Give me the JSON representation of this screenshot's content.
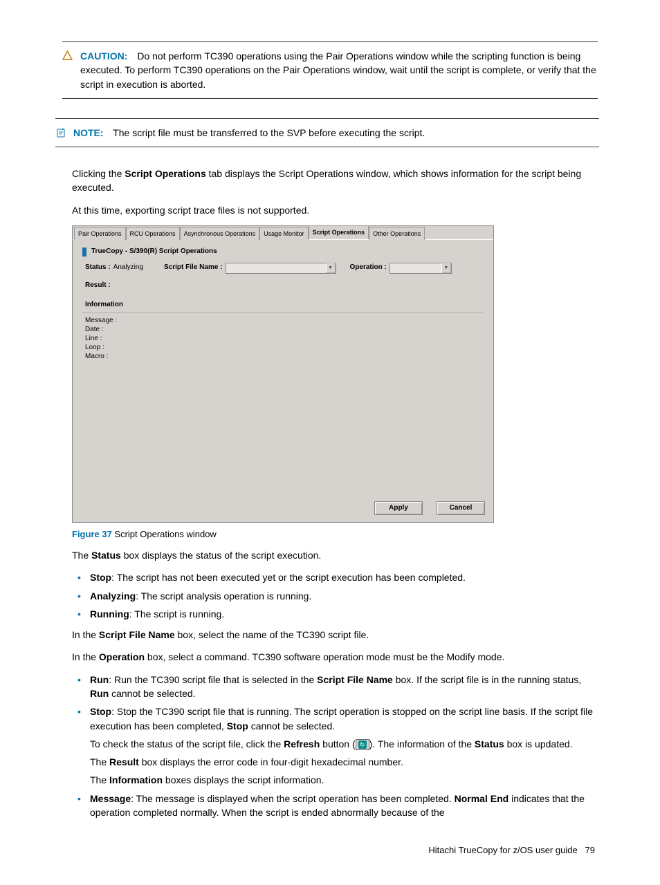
{
  "callouts": {
    "caution": {
      "label": "CAUTION:",
      "text": "Do not perform TC390 operations using the Pair Operations window while the scripting function is being executed. To perform TC390 operations on the Pair Operations window, wait until the script is complete, or verify that the script in execution is aborted."
    },
    "note": {
      "label": "NOTE:",
      "text": "The script file must be transferred to the SVP before executing the script."
    }
  },
  "intro": {
    "p1a": "Clicking the ",
    "p1b": "Script Operations",
    "p1c": " tab displays the Script Operations window, which shows information for the script being executed.",
    "p2": "At this time, exporting script trace files is not supported."
  },
  "app": {
    "tabs": [
      "Pair Operations",
      "RCU Operations",
      "Asynchronous Operations",
      "Usage Monitor",
      "Script Operations",
      "Other Operations"
    ],
    "panel_title": "TrueCopy - S/390(R) Script Operations",
    "labels": {
      "status": "Status :",
      "status_val": "Analyzing",
      "script_file": "Script File Name :",
      "operation": "Operation :",
      "result": "Result :",
      "information": "Information",
      "message": "Message :",
      "date": "Date :",
      "line": "Line :",
      "loop": "Loop :",
      "macro": "Macro :"
    },
    "buttons": {
      "apply": "Apply",
      "cancel": "Cancel"
    }
  },
  "figure": {
    "num": "Figure 37",
    "caption": " Script Operations window"
  },
  "body": {
    "status_line_a": "The ",
    "status_line_b": "Status",
    "status_line_c": " box displays the status of the script execution.",
    "status_items": {
      "stop_b": "Stop",
      "stop_t": ": The script has not been executed yet or the script execution has been completed.",
      "analyzing_b": "Analyzing",
      "analyzing_t": ": The script analysis operation is running.",
      "running_b": "Running",
      "running_t": ": The script is running."
    },
    "sfn_a": "In the ",
    "sfn_b": "Script File Name",
    "sfn_c": " box, select the name of the TC390 script file.",
    "op_a": "In the ",
    "op_b": "Operation",
    "op_c": " box, select a command. TC390 software operation mode must be the Modify mode.",
    "op_items": {
      "run_b": "Run",
      "run_t1": ": Run the TC390 script file that is selected in the ",
      "run_t1b": "Script File Name",
      "run_t2": " box. If the script file is in the running status, ",
      "run_t2b": "Run",
      "run_t3": " cannot be selected.",
      "stop_b": "Stop",
      "stop_t1": ": Stop the TC390 script file that is running. The script operation is stopped on the script line basis. If the script file execution has been completed, ",
      "stop_t1b": "Stop",
      "stop_t2": " cannot be selected.",
      "check_a": "To check the status of the script file, click the ",
      "check_b": "Refresh",
      "check_c": " button (",
      "check_d": "). The information of the ",
      "check_e": "Status",
      "check_f": " box is updated.",
      "result_a": "The ",
      "result_b": "Result",
      "result_c": " box displays the error code in four-digit hexadecimal number.",
      "info_a": "The ",
      "info_b": "Information",
      "info_c": " boxes displays the script information.",
      "msg_b": "Message",
      "msg_t1": ": The message is displayed when the script operation has been completed. ",
      "msg_t1b": "Normal End",
      "msg_t2": " indicates that the operation completed normally. When the script is ended abnormally because of the"
    }
  },
  "footer": {
    "title": "Hitachi TrueCopy for z/OS user guide",
    "page": "79"
  }
}
